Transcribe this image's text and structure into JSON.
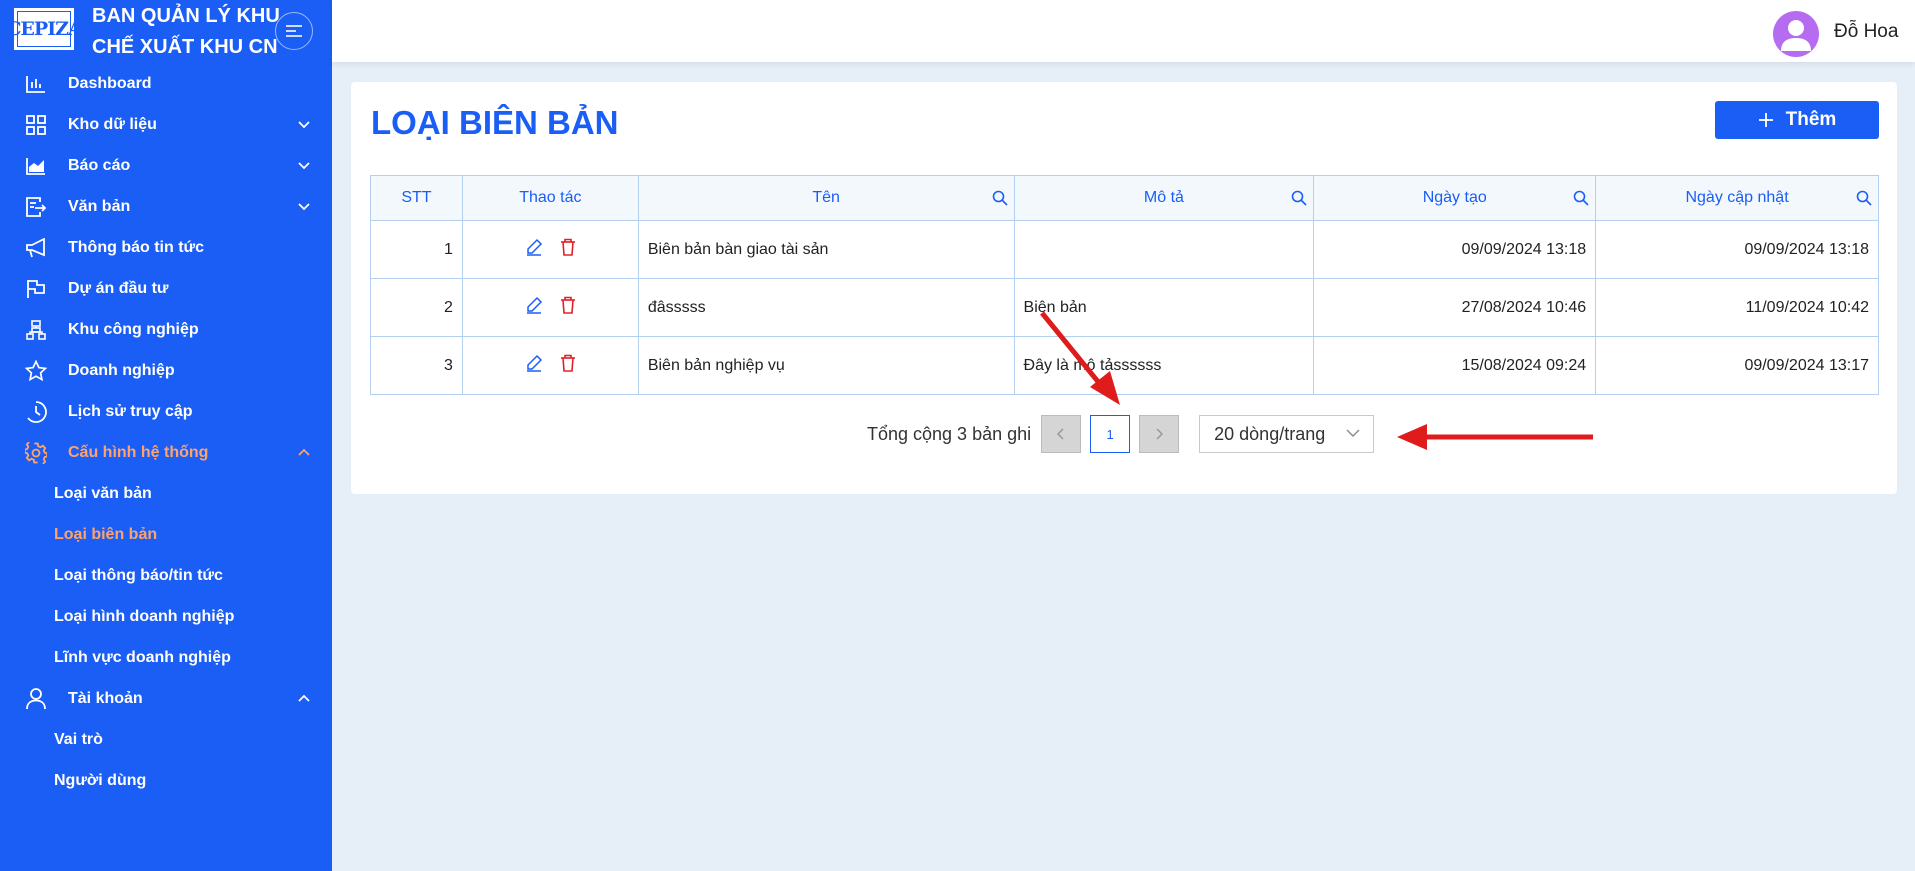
{
  "sidebar": {
    "logo_text": "CEPIZA",
    "org_line1": "BAN QUẢN LÝ KHU",
    "org_line2": "CHẾ XUẤT KHU CN",
    "items": [
      {
        "label": "Dashboard",
        "icon": "bar-chart-icon"
      },
      {
        "label": "Kho dữ liệu",
        "icon": "grid-icon",
        "expandable": true
      },
      {
        "label": "Báo cáo",
        "icon": "area-chart-icon",
        "expandable": true
      },
      {
        "label": "Văn bản",
        "icon": "document-icon",
        "expandable": true
      },
      {
        "label": "Thông báo tin tức",
        "icon": "megaphone-icon"
      },
      {
        "label": "Dự án đầu tư",
        "icon": "flag-icon"
      },
      {
        "label": "Khu công nghiệp",
        "icon": "hierarchy-icon"
      },
      {
        "label": "Doanh nghiệp",
        "icon": "star-icon"
      },
      {
        "label": "Lịch sử truy cập",
        "icon": "history-icon"
      },
      {
        "label": "Cấu hình hệ thống",
        "icon": "gear-icon",
        "expanded": true,
        "active": true
      }
    ],
    "config_sub": [
      "Loại văn bản",
      "Loại biên bản",
      "Loại thông báo/tin tức",
      "Loại hình doanh nghiệp",
      "Lĩnh vực doanh nghiệp"
    ],
    "account": {
      "label": "Tài khoản",
      "icon": "user-icon"
    },
    "account_sub": [
      "Vai trò",
      "Người dùng"
    ]
  },
  "user": {
    "name": "Đỗ Hoa"
  },
  "page": {
    "title": "LOẠI BIÊN BẢN",
    "add_label": "Thêm"
  },
  "table": {
    "headers": [
      "STT",
      "Thao tác",
      "Tên",
      "Mô tả",
      "Ngày tạo",
      "Ngày cập nhật"
    ],
    "rows": [
      {
        "stt": "1",
        "ten": "Biên bản bàn giao tài sản",
        "mota": "",
        "ngaytao": "09/09/2024 13:18",
        "ngaycapnhat": "09/09/2024 13:18"
      },
      {
        "stt": "2",
        "ten": "đâsssss",
        "mota": "Biên bản",
        "ngaytao": "27/08/2024 10:46",
        "ngaycapnhat": "11/09/2024 10:42"
      },
      {
        "stt": "3",
        "ten": "Biên bản nghiệp vụ",
        "mota": "Đây là mô tảssssss",
        "ngaytao": "15/08/2024 09:24",
        "ngaycapnhat": "09/09/2024 13:17"
      }
    ]
  },
  "pagination": {
    "total_text": "Tổng cộng 3 bản ghi",
    "current_page": "1",
    "page_size": "20 dòng/trang"
  },
  "colors": {
    "primary": "#1a5ef5",
    "active_menu": "#ffa36b",
    "delete": "#e0202a",
    "annotation_arrow": "#e01b1b"
  }
}
